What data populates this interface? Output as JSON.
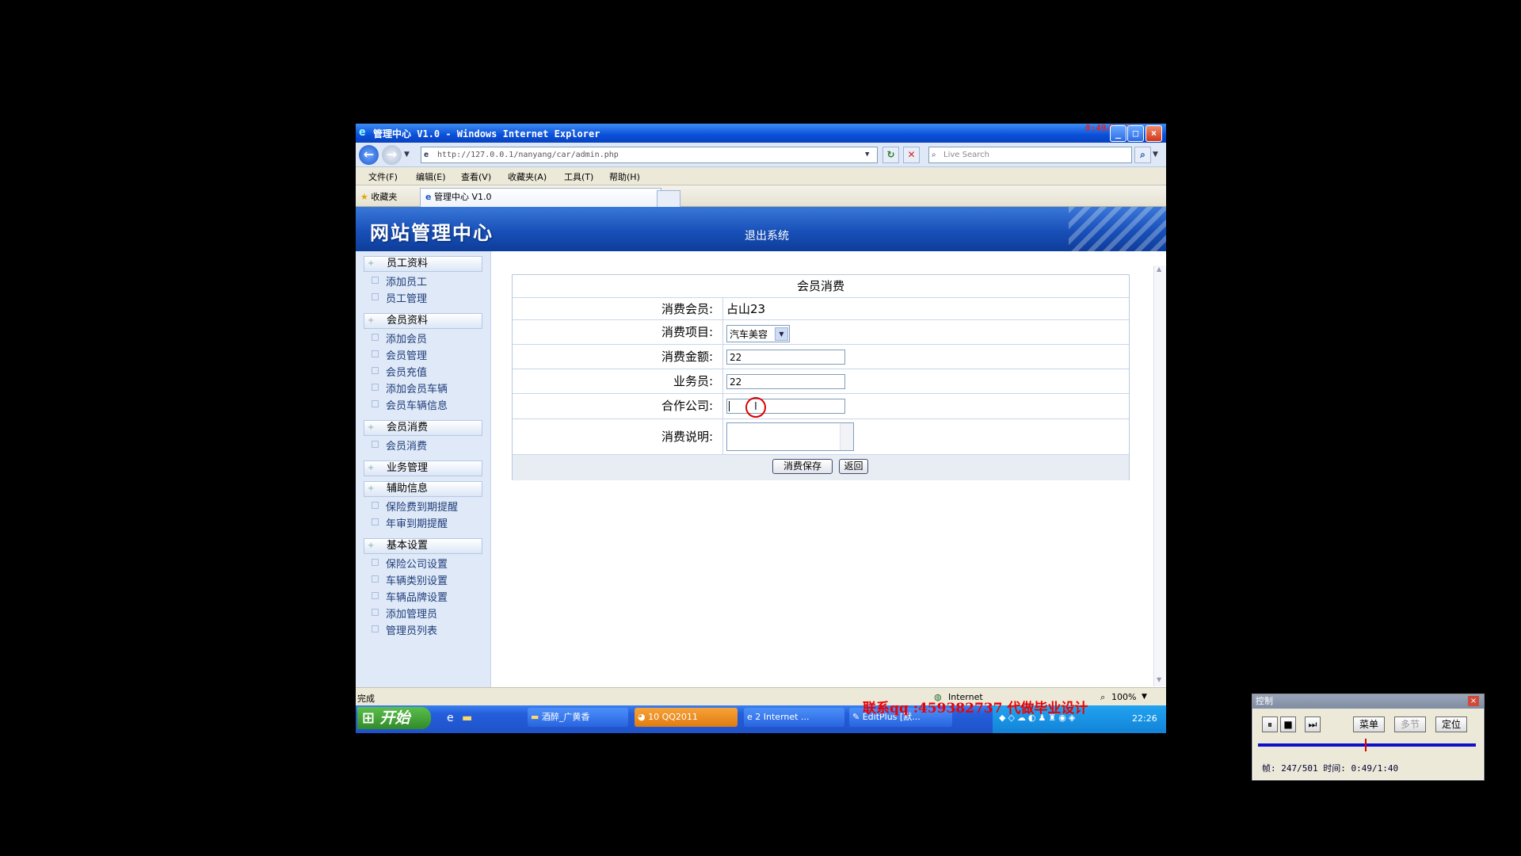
{
  "window": {
    "title": "管理中心 V1.0 - Windows Internet Explorer",
    "overlay_time": "0:49/1:40"
  },
  "browser": {
    "address": "http://127.0.0.1/nanyang/car/admin.php",
    "search_placeholder": "Live Search",
    "menu": [
      "文件(F)",
      "编辑(E)",
      "查看(V)",
      "收藏夹(A)",
      "工具(T)",
      "帮助(H)"
    ],
    "favorites": "收藏夹",
    "tab": "管理中心 V1.0"
  },
  "site": {
    "logo": "网站管理中心",
    "logout": "退出系统"
  },
  "sidebar": {
    "groups": [
      {
        "title": "员工资料",
        "items": [
          "添加员工",
          "员工管理"
        ]
      },
      {
        "title": "会员资料",
        "items": [
          "添加会员",
          "会员管理",
          "会员充值",
          "添加会员车辆",
          "会员车辆信息"
        ]
      },
      {
        "title": "会员消费",
        "items": [
          "会员消费"
        ]
      },
      {
        "title": "业务管理",
        "items": []
      },
      {
        "title": "辅助信息",
        "items": [
          "保险费到期提醒",
          "年审到期提醒"
        ]
      },
      {
        "title": "基本设置",
        "items": [
          "保险公司设置",
          "车辆类别设置",
          "车辆品牌设置",
          "添加管理员",
          "管理员列表"
        ]
      }
    ]
  },
  "form": {
    "title": "会员消费",
    "member_label": "消费会员:",
    "member_value": "占山23",
    "item_label": "消费项目:",
    "item_value": "汽车美容",
    "amount_label": "消费金额:",
    "amount_value": "22",
    "agent_label": "业务员:",
    "agent_value": "22",
    "partner_label": "合作公司:",
    "partner_value": "",
    "note_label": "消费说明:",
    "note_value": "",
    "save_btn": "消费保存",
    "back_btn": "返回"
  },
  "status": {
    "left": "完成",
    "zone": "Internet",
    "zoom": "100%"
  },
  "taskbar": {
    "start": "开始",
    "tasks": [
      "酒醉_广黄香",
      "10 QQ2011",
      "2 Internet ...",
      "EditPlus [默..."
    ],
    "clock": "22:26"
  },
  "watermark": "联系qq :459382737 代做毕业设计",
  "control": {
    "title": "控制",
    "btn_menu": "菜单",
    "btn_multi": "多节",
    "btn_locate": "定位",
    "progress": 0.49,
    "info": "帧: 247/501 时间: 0:49/1:40"
  }
}
